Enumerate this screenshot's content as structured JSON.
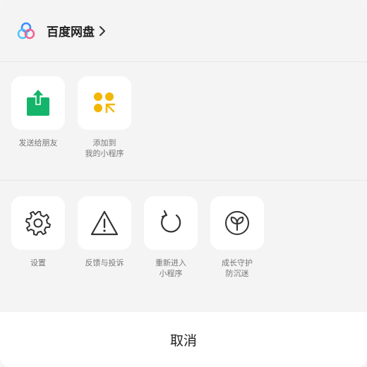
{
  "header": {
    "title": "百度网盘",
    "logo_icon": "baidu-netdisk-logo",
    "chevron_icon": "chevron-right-icon"
  },
  "actions_row1": [
    {
      "label": "发送给朋友",
      "icon": "share-icon",
      "color": "#15b46b"
    },
    {
      "label": "添加到\n我的小程序",
      "icon": "mini-program-add-icon",
      "color": "#f2b705"
    }
  ],
  "actions_row2": [
    {
      "label": "设置",
      "icon": "gear-icon"
    },
    {
      "label": "反馈与投诉",
      "icon": "warning-icon"
    },
    {
      "label": "重新进入\n小程序",
      "icon": "reload-icon"
    },
    {
      "label": "成长守护\n防沉迷",
      "icon": "sprout-icon"
    }
  ],
  "cancel_label": "取消"
}
